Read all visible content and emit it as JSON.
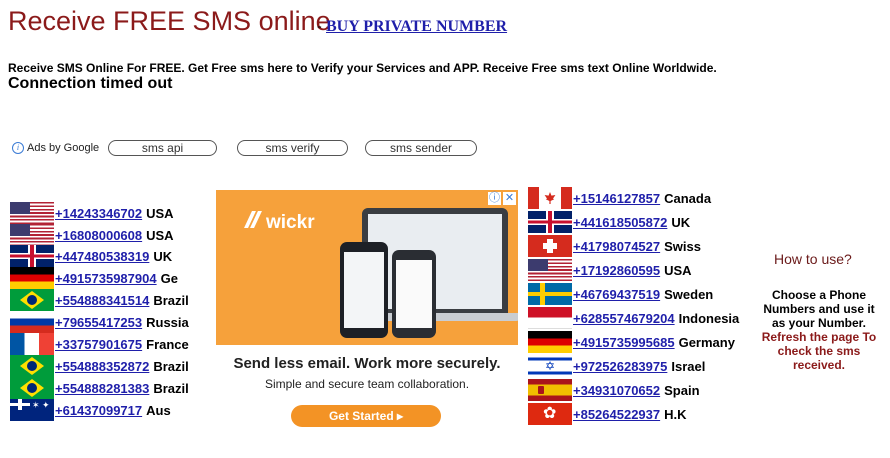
{
  "header": {
    "title": "Receive FREE SMS online",
    "separator": "-",
    "buy_link": "BUY PRIVATE NUMBER"
  },
  "intro_text": "Receive SMS Online For FREE. Get Free sms here to Verify your Services and APP. Receive Free sms text Online Worldwide.",
  "status_text": "Connection timed out",
  "ads_bar": {
    "label": "Ads by Google",
    "info_glyph": "i",
    "chips": [
      "sms api",
      "sms verify",
      "sms sender"
    ]
  },
  "left_numbers": [
    {
      "flag": "us-flag-icon",
      "number": "+14243346702",
      "country": "USA"
    },
    {
      "flag": "us-flag-icon",
      "number": "+16808000608",
      "country": "USA"
    },
    {
      "flag": "uk-flag-icon",
      "number": "+447480538319",
      "country": "UK"
    },
    {
      "flag": "germany-flag-icon",
      "number": "+4915735987904",
      "country": "Ge"
    },
    {
      "flag": "brazil-flag-icon",
      "number": "+554888341514",
      "country": "Brazil"
    },
    {
      "flag": "russia-flag-icon",
      "number": "+79655417253",
      "country": "Russia"
    },
    {
      "flag": "france-flag-icon",
      "number": "+33757901675",
      "country": "France"
    },
    {
      "flag": "brazil-flag-icon",
      "number": "+554888352872",
      "country": "Brazil"
    },
    {
      "flag": "brazil-flag-icon",
      "number": "+554888281383",
      "country": "Brazil"
    },
    {
      "flag": "australia-flag-icon",
      "number": "+61437099717",
      "country": "Aus"
    }
  ],
  "right_numbers": [
    {
      "flag": "canada-flag-icon",
      "number": "+15146127857",
      "country": "Canada"
    },
    {
      "flag": "uk-flag-icon",
      "number": "+441618505872",
      "country": "UK"
    },
    {
      "flag": "swiss-flag-icon",
      "number": "+41798074527",
      "country": "Swiss"
    },
    {
      "flag": "us-flag-icon",
      "number": "+17192860595",
      "country": "USA"
    },
    {
      "flag": "sweden-flag-icon",
      "number": "+46769437519",
      "country": "Sweden"
    },
    {
      "flag": "indonesia-flag-icon",
      "number": "+6285574679204",
      "country": "Indonesia"
    },
    {
      "flag": "germany-flag-icon",
      "number": "+4915735995685",
      "country": "Germany"
    },
    {
      "flag": "israel-flag-icon",
      "number": "+972526283975",
      "country": "Israel"
    },
    {
      "flag": "spain-flag-icon",
      "number": "+34931070652",
      "country": "Spain"
    },
    {
      "flag": "hongkong-flag-icon",
      "number": "+85264522937",
      "country": "H.K"
    }
  ],
  "ad": {
    "brand": "wickr",
    "headline": "Send less email. Work more securely.",
    "subline": "Simple and secure team collaboration.",
    "cta": "Get Started ▸",
    "icons": [
      "ad-info-icon",
      "ad-close-icon"
    ],
    "info_glyph": "ⓘ",
    "close_glyph": "✕",
    "accent_color": "#f6a13b"
  },
  "help": {
    "heading": "How to use?",
    "text_black": "Choose a Phone Numbers and use it as your Number.",
    "text_red": "Refresh the page To check the sms received."
  },
  "colors": {
    "title": "#8b1a1a",
    "link": "#1f1faa",
    "help_red": "#8b1a1a"
  }
}
